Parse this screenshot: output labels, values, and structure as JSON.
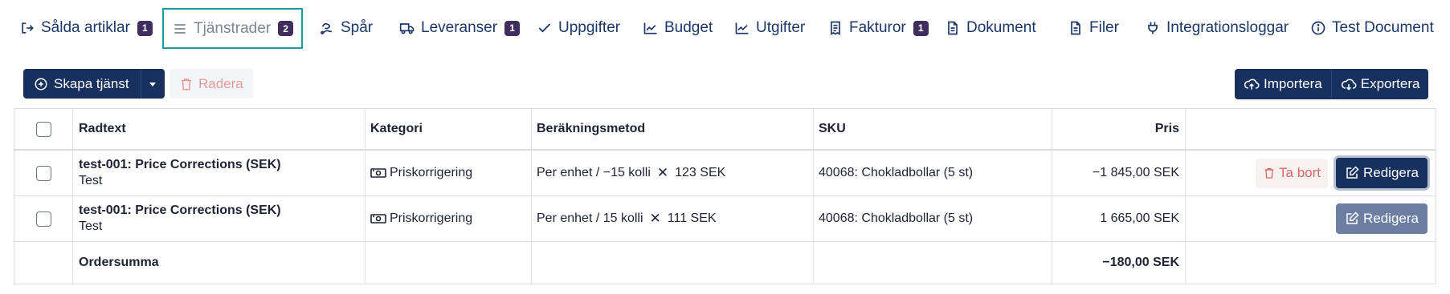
{
  "tabs": [
    {
      "label": "Sålda artiklar",
      "icon": "sign-out-icon",
      "badge": "1"
    },
    {
      "label": "Tjänstrader",
      "icon": "list-icon",
      "badge": "2",
      "active": true
    },
    {
      "label": "Spår",
      "icon": "route-icon"
    },
    {
      "label": "Leveranser",
      "icon": "truck-icon",
      "badge": "1"
    },
    {
      "label": "Uppgifter",
      "icon": "check-icon"
    },
    {
      "label": "Budget",
      "icon": "chart-line-icon"
    },
    {
      "label": "Utgifter",
      "icon": "chart-line-icon"
    },
    {
      "label": "Fakturor",
      "icon": "invoice-icon",
      "badge": "1"
    },
    {
      "label": "Dokument",
      "icon": "document-icon"
    },
    {
      "label": "Filer",
      "icon": "file-icon"
    },
    {
      "label": "Integrationsloggar",
      "icon": "plug-icon"
    },
    {
      "label": "Test Document",
      "icon": "info-icon"
    }
  ],
  "toolbar": {
    "create_label": "Skapa tjänst",
    "delete_label": "Radera",
    "import_label": "Importera",
    "export_label": "Exportera"
  },
  "table": {
    "columns": [
      "Radtext",
      "Kategori",
      "Beräkningsmetod",
      "SKU",
      "Pris"
    ],
    "rows": [
      {
        "title": "test-001: Price Corrections (SEK)",
        "subtitle": "Test",
        "category": "Priskorrigering",
        "method_left": "Per enhet / −15 kolli",
        "method_times": "✕",
        "method_right": "123 SEK",
        "sku": "40068: Chokladbollar (5 st)",
        "price": "−1 845,00 SEK",
        "remove_label": "Ta bort",
        "edit_label": "Redigera"
      },
      {
        "title": "test-001: Price Corrections (SEK)",
        "subtitle": "Test",
        "category": "Priskorrigering",
        "method_left": "Per enhet / 15 kolli",
        "method_times": "✕",
        "method_right": "111 SEK",
        "sku": "40068: Chokladbollar (5 st)",
        "price": "1 665,00 SEK",
        "edit_label": "Redigera"
      }
    ],
    "total_label": "Ordersumma",
    "total_value": "−180,00 SEK"
  },
  "colors": {
    "primary": "#17305e",
    "active_tab_border": "#1a9c9c",
    "badge": "#3f2d5e",
    "danger": "#d56764"
  }
}
